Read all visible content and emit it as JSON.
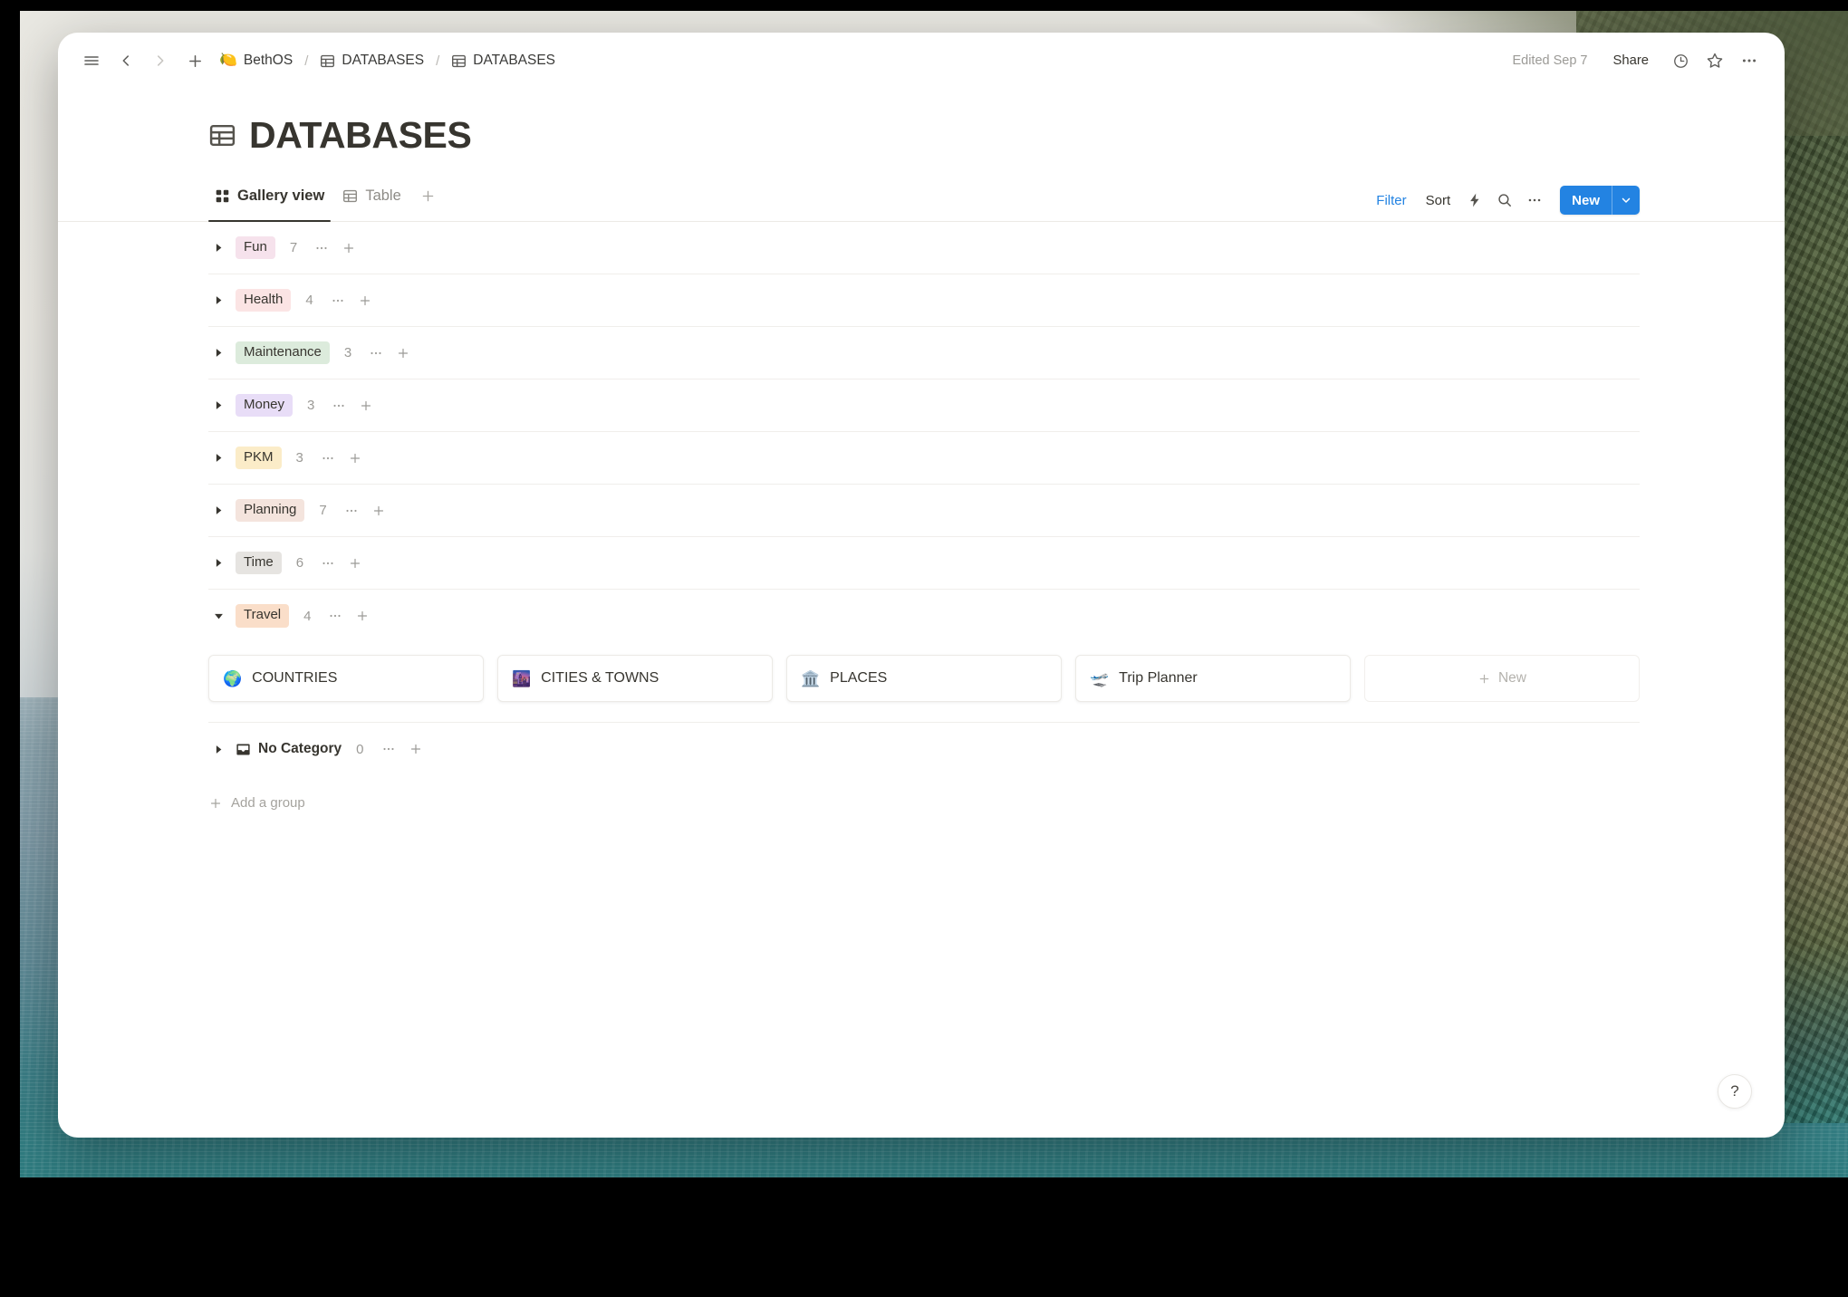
{
  "topbar": {
    "menu_icon": "hamburger-menu-icon",
    "back_icon": "chevron-left-icon",
    "forward_icon": "chevron-right-icon",
    "new_page_icon": "plus-icon",
    "breadcrumb": [
      {
        "emoji": "🍋",
        "label": "BethOS",
        "icon": "lemon-emoji"
      },
      {
        "emoji": "",
        "label": "DATABASES",
        "icon": "table-icon"
      },
      {
        "emoji": "",
        "label": "DATABASES",
        "icon": "table-icon"
      }
    ],
    "separator": "/",
    "edited": "Edited Sep 7",
    "share": "Share",
    "history_icon": "clock-icon",
    "favorite_icon": "star-icon",
    "more_icon": "ellipsis-icon"
  },
  "page": {
    "title": "DATABASES",
    "title_icon": "table-icon"
  },
  "views": {
    "tabs": [
      {
        "label": "Gallery view",
        "icon": "gallery-grid-icon",
        "active": true
      },
      {
        "label": "Table",
        "icon": "table-icon",
        "active": false
      }
    ],
    "add_view_icon": "plus-icon"
  },
  "toolbar": {
    "filter": "Filter",
    "sort": "Sort",
    "automation_icon": "lightning-bolt-icon",
    "search_icon": "search-icon",
    "more_icon": "ellipsis-icon",
    "new_label": "New",
    "new_chevron_icon": "chevron-down-icon",
    "accent_color": "#2383e2",
    "filter_color": "#2383e2"
  },
  "groups": [
    {
      "name": "Fun",
      "count": "7",
      "expanded": false,
      "bg": "#f6e2ec",
      "fg": "#3b3a37"
    },
    {
      "name": "Health",
      "count": "4",
      "expanded": false,
      "bg": "#fbe4e4",
      "fg": "#3b3a37"
    },
    {
      "name": "Maintenance",
      "count": "3",
      "expanded": false,
      "bg": "#dcebdc",
      "fg": "#3b3a37"
    },
    {
      "name": "Money",
      "count": "3",
      "expanded": false,
      "bg": "#e8ddf7",
      "fg": "#3b3a37"
    },
    {
      "name": "PKM",
      "count": "3",
      "expanded": false,
      "bg": "#fbecc8",
      "fg": "#3b3a37"
    },
    {
      "name": "Planning",
      "count": "7",
      "expanded": false,
      "bg": "#f4e4dd",
      "fg": "#3b3a37"
    },
    {
      "name": "Time",
      "count": "6",
      "expanded": false,
      "bg": "#e6e4e1",
      "fg": "#3b3a37"
    },
    {
      "name": "Travel",
      "count": "4",
      "expanded": true,
      "bg": "#fadec9",
      "fg": "#3b3a37"
    }
  ],
  "travel_cards": [
    {
      "emoji": "🌍",
      "name": "COUNTRIES",
      "icon": "globe-emoji"
    },
    {
      "emoji": "🌆",
      "name": "CITIES & TOWNS",
      "icon": "cityscape-emoji"
    },
    {
      "emoji": "🏛️",
      "name": "PLACES",
      "icon": "classical-building-emoji"
    },
    {
      "emoji": "🛫",
      "name": "Trip Planner",
      "icon": "airplane-departure-emoji"
    }
  ],
  "new_card": {
    "label": "New",
    "icon": "plus-icon"
  },
  "no_category": {
    "label": "No Category",
    "count": "0",
    "icon": "inbox-tray-icon"
  },
  "add_group": {
    "label": "Add a group",
    "icon": "plus-icon"
  },
  "help": {
    "label": "?"
  },
  "row_icons": {
    "caret_collapsed": "caret-right-icon",
    "caret_expanded": "caret-down-icon",
    "dots": "ellipsis-icon",
    "plus": "plus-icon"
  }
}
